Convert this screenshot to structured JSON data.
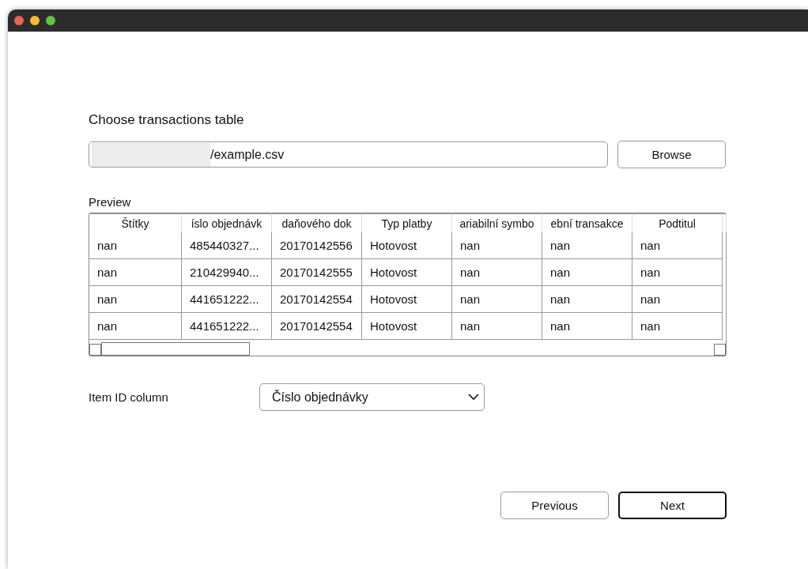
{
  "file_section": {
    "heading": "Choose transactions table",
    "path_value": "/example.csv",
    "browse_button": "Browse"
  },
  "preview": {
    "label": "Preview",
    "table": {
      "columns": [
        "Štítky",
        "íslo objednávk",
        "daňového dok",
        "Typ platby",
        "ariabilní symbo",
        "ební transakce",
        "Podtitul"
      ],
      "rows": [
        [
          "nan",
          "485440327...",
          "20170142556",
          "Hotovost",
          "nan",
          "nan",
          "nan"
        ],
        [
          "nan",
          "210429940...",
          "20170142555",
          "Hotovost",
          "nan",
          "nan",
          "nan"
        ],
        [
          "nan",
          "441651222...",
          "20170142554",
          "Hotovost",
          "nan",
          "nan",
          "nan"
        ],
        [
          "nan",
          "441651222...",
          "20170142554",
          "Hotovost",
          "nan",
          "nan",
          "nan"
        ]
      ]
    }
  },
  "item_id": {
    "label": "Item ID column",
    "value": "Číslo objednávky"
  },
  "buttons": [
    {
      "label": "Previous",
      "default": false
    },
    {
      "label": "Next",
      "default": true
    }
  ]
}
